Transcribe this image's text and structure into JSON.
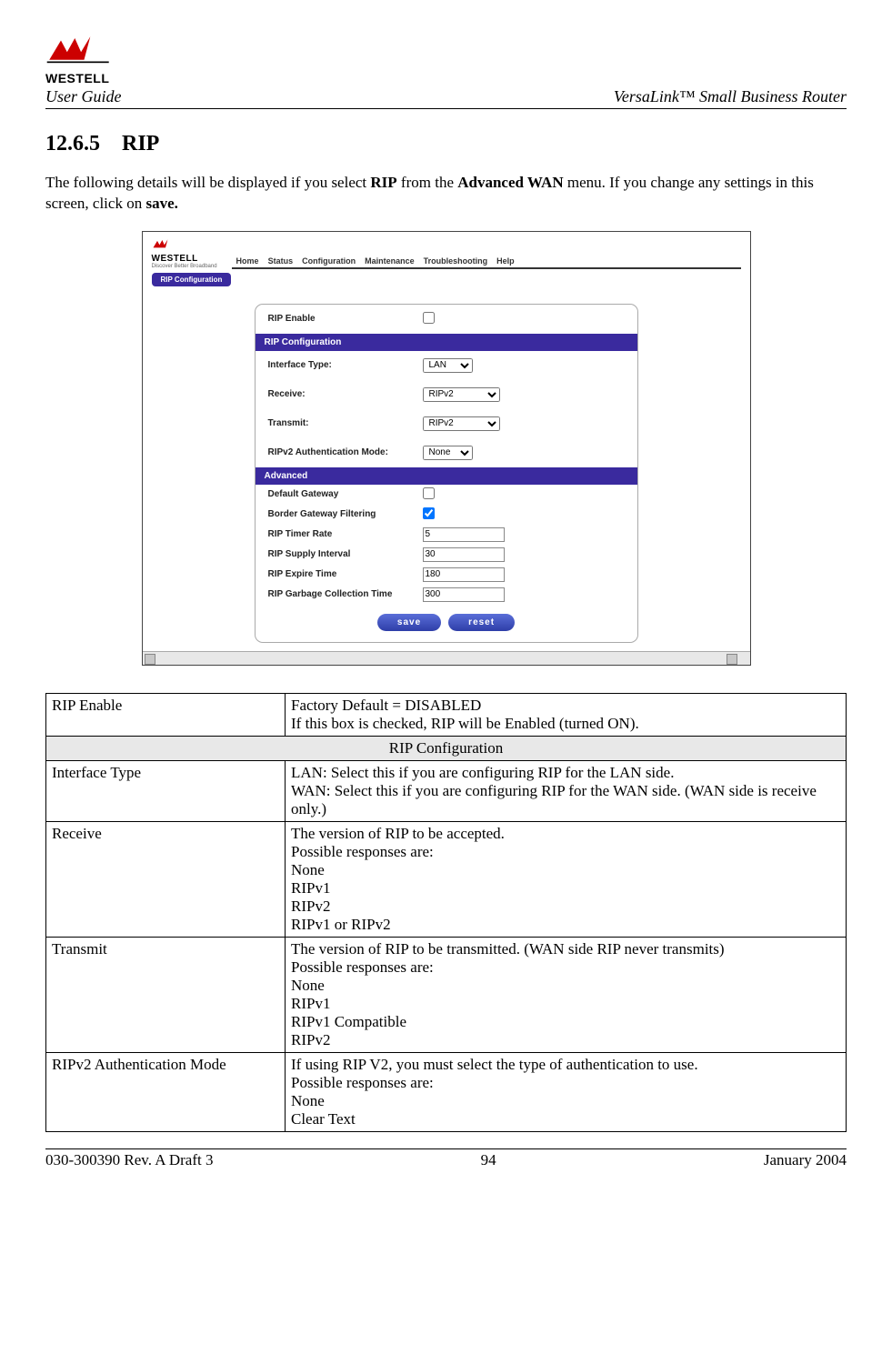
{
  "header": {
    "brand": "WESTELL",
    "user_guide": "User Guide",
    "product": "VersaLink™  Small Business Router"
  },
  "section": {
    "number": "12.6.5",
    "title": "RIP"
  },
  "intro": {
    "text_before_rip": "The following details will be displayed if you select ",
    "bold_rip": "RIP",
    "mid": " from the ",
    "bold_menu": "Advanced WAN",
    "after_menu": " menu. If you change any settings in this screen, click on ",
    "bold_save": "save."
  },
  "router_ui": {
    "brand": "WESTELL",
    "tagline": "Discover Better Broadband",
    "nav": [
      "Home",
      "Status",
      "Configuration",
      "Maintenance",
      "Troubleshooting",
      "Help"
    ],
    "tab": "RIP Configuration",
    "rip_enable_label": "RIP Enable",
    "config_head": "RIP Configuration",
    "fields": {
      "iface_label": "Interface Type:",
      "iface_value": "LAN",
      "recv_label": "Receive:",
      "recv_value": "RIPv2",
      "trans_label": "Transmit:",
      "trans_value": "RIPv2",
      "auth_label": "RIPv2 Authentication Mode:",
      "auth_value": "None"
    },
    "adv_head": "Advanced",
    "adv": {
      "gw_label": "Default Gateway",
      "bgf_label": "Border Gateway Filtering",
      "timer_label": "RIP Timer Rate",
      "timer_value": "5",
      "supply_label": "RIP Supply Interval",
      "supply_value": "30",
      "expire_label": "RIP Expire Time",
      "expire_value": "180",
      "garbage_label": "RIP Garbage Collection Time",
      "garbage_value": "300"
    },
    "btn_save": "save",
    "btn_reset": "reset"
  },
  "table": {
    "rip_enable": {
      "name": "RIP Enable",
      "desc": "Factory Default = DISABLED\nIf this box is checked, RIP will be Enabled (turned ON)."
    },
    "config_header": "RIP Configuration",
    "iface": {
      "name": "Interface Type",
      "desc": "LAN: Select this if you are configuring RIP for the LAN side.\nWAN: Select this if you are configuring RIP for the WAN side. (WAN side is receive only.)"
    },
    "receive": {
      "name": "Receive",
      "desc": "The version of RIP to be accepted.\nPossible responses are:\nNone\nRIPv1\nRIPv2\nRIPv1 or RIPv2"
    },
    "transmit": {
      "name": "Transmit",
      "desc": "The version of RIP to be transmitted. (WAN side RIP never transmits)\nPossible responses are:\nNone\nRIPv1\nRIPv1 Compatible\nRIPv2"
    },
    "auth": {
      "name": "RIPv2 Authentication Mode",
      "desc": "If using RIP V2, you must select the type of authentication to use.\nPossible responses are:\nNone\nClear Text"
    }
  },
  "footer": {
    "left": "030-300390 Rev. A Draft 3",
    "center": "94",
    "right": "January 2004"
  }
}
